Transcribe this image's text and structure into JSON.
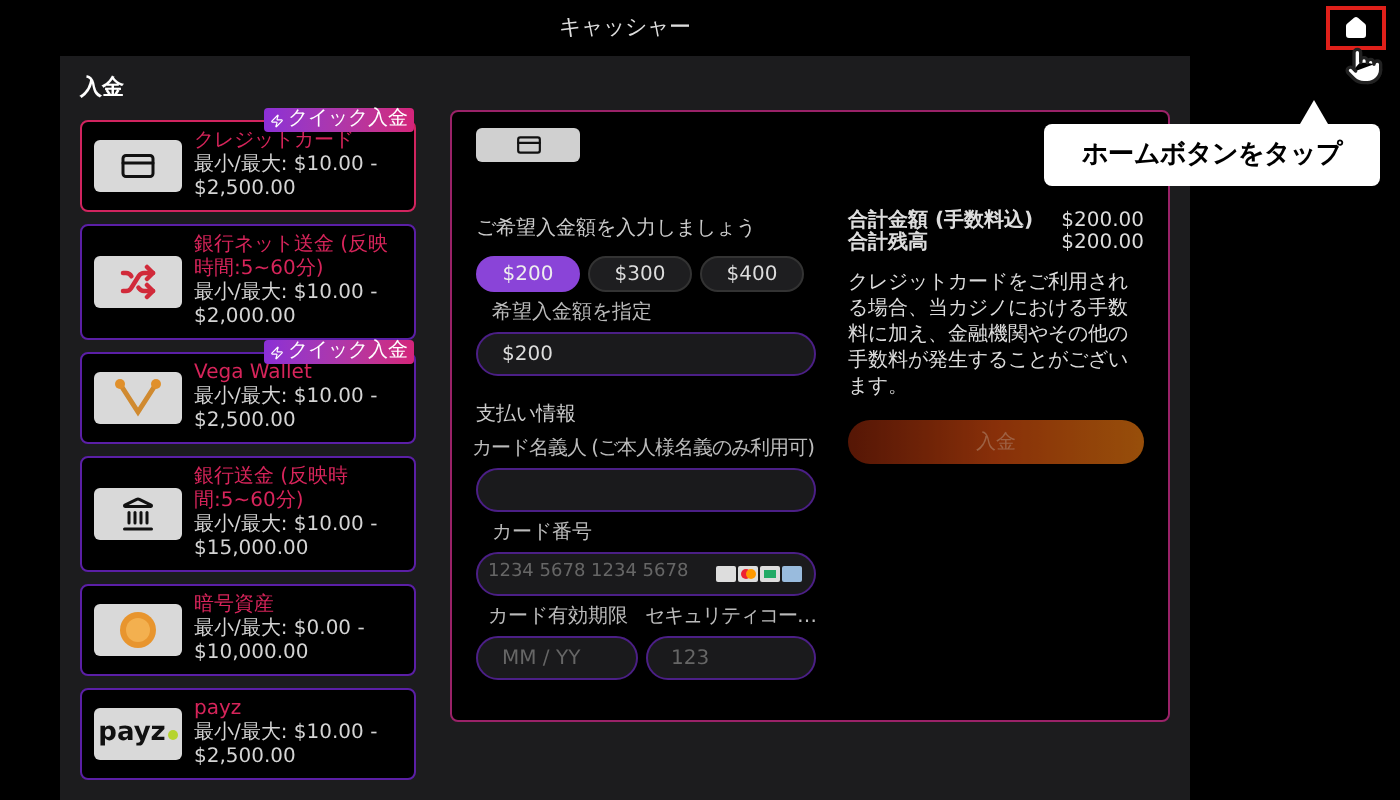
{
  "header": {
    "title": "キャッシャー"
  },
  "section_title": "入金",
  "methods": [
    {
      "name": "クレジットカード",
      "limits": "最小/最大: $10.00 - $2,500.00",
      "kind": "card",
      "badge": "クイック入金",
      "selected": true
    },
    {
      "name": "銀行ネット送金 (反映時間:5~60分)",
      "limits": "最小/最大: $10.00 - $2,000.00",
      "kind": "shuffle",
      "selected": false
    },
    {
      "name": "Vega Wallet",
      "limits": "最小/最大: $10.00 - $2,500.00",
      "kind": "vega",
      "badge": "クイック入金",
      "selected": false
    },
    {
      "name": "銀行送金 (反映時間:5~60分)",
      "limits": "最小/最大: $10.00 - $15,000.00",
      "kind": "bank",
      "selected": false
    },
    {
      "name": "暗号資産",
      "limits": "最小/最大: $0.00 - $10,000.00",
      "kind": "coin",
      "selected": false
    },
    {
      "name": "payz",
      "limits": "最小/最大: $10.00 - $2,500.00",
      "kind": "text",
      "logo_text": "payz",
      "selected": false
    }
  ],
  "form": {
    "amount_heading": "ご希望入金額を入力しましょう",
    "amounts": [
      {
        "label": "$200",
        "selected": true
      },
      {
        "label": "$300",
        "selected": false
      },
      {
        "label": "$400",
        "selected": false
      }
    ],
    "custom_amount": {
      "label": "希望入金額を指定",
      "value": "$200"
    },
    "payment_heading": "支払い情報",
    "cardholder": {
      "label": "カード名義人 (ご本人様名義のみ利用可)"
    },
    "card_number": {
      "label": "カード番号",
      "placeholder": "1234 5678 1234 5678"
    },
    "expiry": {
      "label": "カード有効期限",
      "placeholder": "MM / YY"
    },
    "cvv": {
      "label": "セキュリティコー…",
      "placeholder": "123"
    }
  },
  "summary": {
    "rows": [
      {
        "label": "合計金額 (手数料込)",
        "value": "$200.00"
      },
      {
        "label": "合計残高",
        "value": "$200.00"
      }
    ],
    "notice": "クレジットカードをご利用される場合、当カジノにおける手数料に加え、金融機関やその他の手数料が発生することがございます。",
    "submit": {
      "label": "入金",
      "disabled": true
    }
  },
  "tooltip": {
    "text": "ホームボタンをタップ"
  }
}
